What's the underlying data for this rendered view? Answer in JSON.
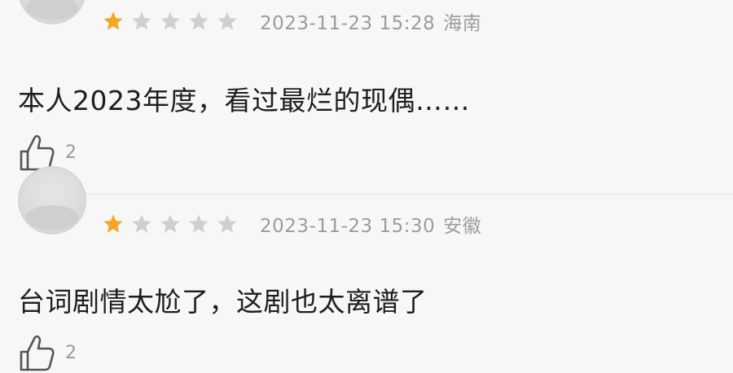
{
  "colors": {
    "background": "#f7f7f7",
    "star_filled": "#f5a623",
    "star_empty": "#cfcfcf",
    "meta_text": "#9c9c9c",
    "content_text": "#1e1e1e"
  },
  "reviews": [
    {
      "rating": 1,
      "max_rating": 5,
      "timestamp": "2023-11-23 15:28",
      "location": "海南",
      "content": "本人2023年度，看过最烂的现偶……",
      "like_icon": "thumbs-up-icon",
      "likes": "2"
    },
    {
      "rating": 1,
      "max_rating": 5,
      "timestamp": "2023-11-23 15:30",
      "location": "安徽",
      "content": "台词剧情太尬了，这剧也太离谱了",
      "like_icon": "thumbs-up-icon",
      "likes": "2"
    }
  ]
}
